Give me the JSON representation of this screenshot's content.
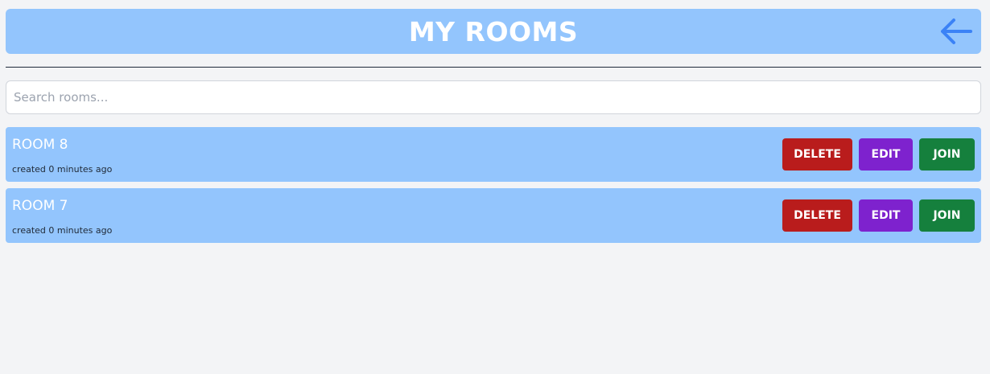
{
  "header": {
    "title": "MY ROOMS",
    "back_icon": "arrow-left-icon"
  },
  "search": {
    "placeholder": "Search rooms...",
    "value": ""
  },
  "rooms": [
    {
      "name": "ROOM 8",
      "created": "created 0 minutes ago",
      "delete_label": "DELETE",
      "edit_label": "EDIT",
      "join_label": "JOIN"
    },
    {
      "name": "ROOM 7",
      "created": "created 0 minutes ago",
      "delete_label": "DELETE",
      "edit_label": "EDIT",
      "join_label": "JOIN"
    }
  ],
  "colors": {
    "header_bg": "#93c5fd",
    "delete": "#b91c1c",
    "edit": "#7e22ce",
    "join": "#15803d",
    "back_icon": "#3b82f6"
  }
}
